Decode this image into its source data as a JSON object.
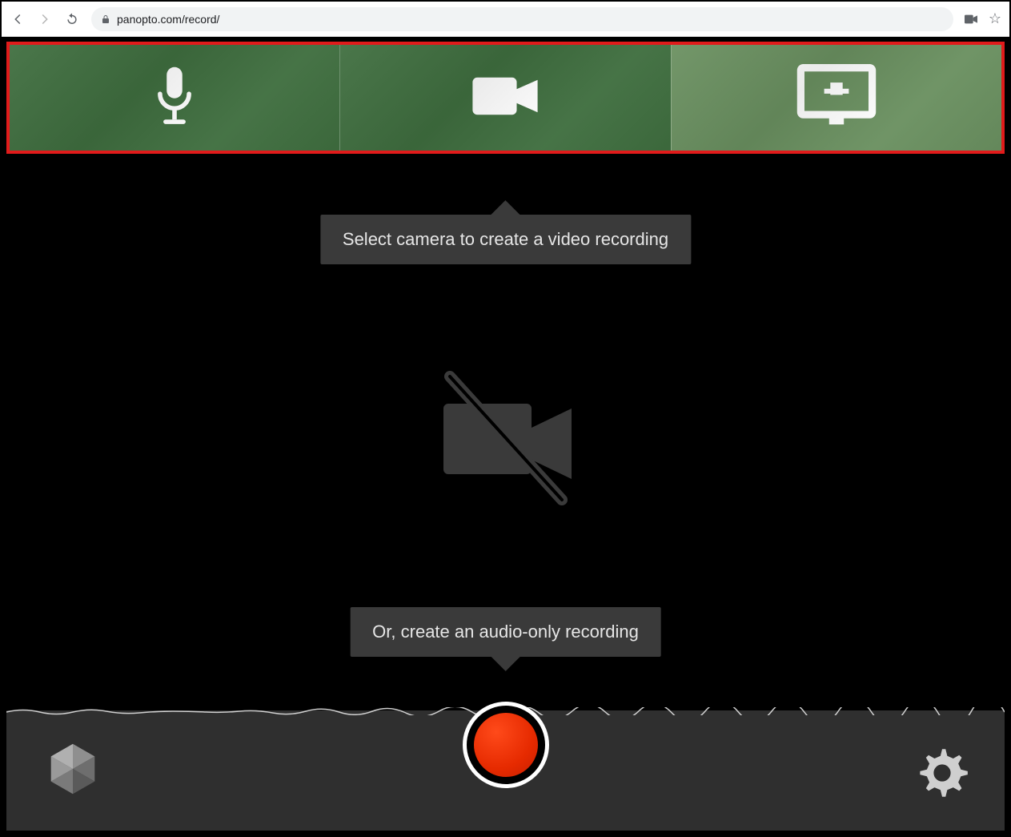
{
  "browser": {
    "url": "panopto.com/record/"
  },
  "toolbar": {
    "items": [
      {
        "name": "microphone"
      },
      {
        "name": "camera"
      },
      {
        "name": "screen-share"
      }
    ]
  },
  "tooltips": {
    "camera_hint": "Select camera to create a video recording",
    "audio_hint": "Or, create an audio-only recording"
  },
  "icons": {
    "nocam": "camera-off-icon",
    "record": "record-button",
    "settings": "gear-icon",
    "logo": "panopto-logo"
  }
}
